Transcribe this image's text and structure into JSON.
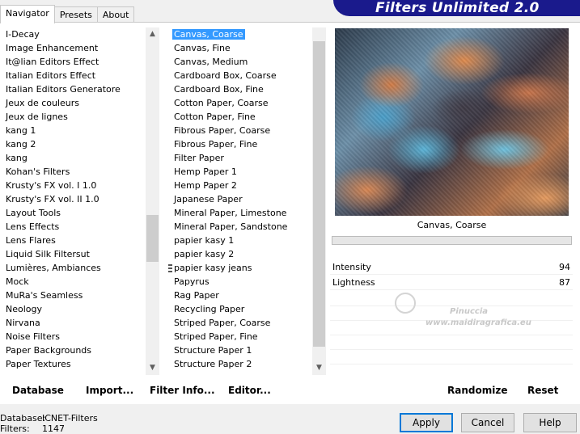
{
  "tabs": [
    {
      "label": "Navigator"
    },
    {
      "label": "Presets"
    },
    {
      "label": "About"
    }
  ],
  "banner_title": "Filters Unlimited 2.0",
  "categories": [
    "I-Decay",
    "Image Enhancement",
    "It@lian Editors Effect",
    "Italian Editors Effect",
    "Italian Editors Generatore",
    "Jeux de couleurs",
    "Jeux de lignes",
    "kang 1",
    "kang 2",
    "kang",
    "Kohan's Filters",
    "Krusty's FX vol. I 1.0",
    "Krusty's FX vol. II 1.0",
    "Layout Tools",
    "Lens Effects",
    "Lens Flares",
    "Liquid Silk Filtersut",
    "Lumières, Ambiances",
    "Mock",
    "MuRa's Seamless",
    "Neology",
    "Nirvana",
    "Noise Filters",
    "Paper Backgrounds",
    "Paper Textures"
  ],
  "filters": [
    "Canvas, Coarse",
    "Canvas, Fine",
    "Canvas, Medium",
    "Cardboard Box, Coarse",
    "Cardboard Box, Fine",
    "Cotton Paper, Coarse",
    "Cotton Paper, Fine",
    "Fibrous Paper, Coarse",
    "Fibrous Paper, Fine",
    "Filter Paper",
    "Hemp Paper 1",
    "Hemp Paper 2",
    "Japanese Paper",
    "Mineral Paper, Limestone",
    "Mineral Paper, Sandstone",
    "papier kasy 1",
    "papier kasy 2",
    "papier kasy jeans",
    "Papyrus",
    "Rag Paper",
    "Recycling Paper",
    "Striped Paper, Coarse",
    "Striped Paper, Fine",
    "Structure Paper 1",
    "Structure Paper 2"
  ],
  "selected_filter": "Canvas, Coarse",
  "preview_caption": "Canvas, Coarse",
  "params": [
    {
      "name": "Intensity",
      "value": "94"
    },
    {
      "name": "Lightness",
      "value": "87"
    }
  ],
  "watermark": {
    "line1": "Pinuccia",
    "line2": "www.maidiragrafica.eu"
  },
  "toolbar": {
    "database": "Database",
    "import": "Import...",
    "filter_info": "Filter Info...",
    "editor": "Editor...",
    "randomize": "Randomize",
    "reset": "Reset"
  },
  "status": {
    "database_label": "Database:",
    "database_value": "ICNET-Filters",
    "filters_label": "Filters:",
    "filters_value": "1147"
  },
  "buttons": {
    "apply": "Apply",
    "cancel": "Cancel",
    "help": "Help"
  }
}
